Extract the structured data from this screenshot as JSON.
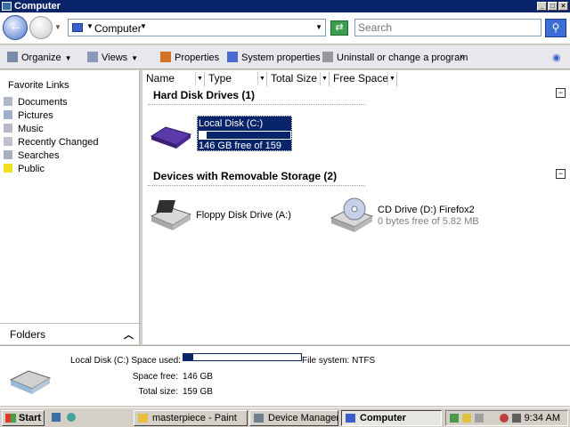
{
  "window": {
    "title": "Computer"
  },
  "address": {
    "location": "Computer",
    "search_placeholder": "Search"
  },
  "toolbar": {
    "organize": "Organize",
    "views": "Views",
    "properties": "Properties",
    "system_properties": "System properties",
    "uninstall": "Uninstall or change a program",
    "more": "»"
  },
  "sidebar": {
    "header": "Favorite Links",
    "items": [
      {
        "label": "Documents"
      },
      {
        "label": "Pictures"
      },
      {
        "label": "Music"
      },
      {
        "label": "Recently Changed"
      },
      {
        "label": "Searches"
      },
      {
        "label": "Public"
      }
    ],
    "folders_label": "Folders"
  },
  "columns": [
    "Name",
    "Type",
    "Total Size",
    "Free Space"
  ],
  "groups": {
    "hard_disks": {
      "heading": "Hard Disk Drives (1)",
      "drives": [
        {
          "name": "Local Disk (C:)",
          "free_text": "146 GB free of 159 GB",
          "used_fraction": 0.08
        }
      ]
    },
    "removable": {
      "heading": "Devices with Removable Storage (2)",
      "drives": [
        {
          "name": "Floppy Disk Drive (A:)"
        },
        {
          "name": "CD Drive (D:) Firefox2",
          "free_text": "0 bytes free of 5.82 MB"
        }
      ]
    }
  },
  "details": {
    "title": "Local Disk (C:) Space used:",
    "file_system": "File system: NTFS",
    "space_free_label": "Space free:",
    "space_free": "146 GB",
    "total_size_label": "Total size:",
    "total_size": "159 GB",
    "used_fraction": 0.08
  },
  "taskbar": {
    "start": "Start",
    "tasks": [
      {
        "label": "masterpiece - Paint"
      },
      {
        "label": "Device Manager"
      },
      {
        "label": "Computer",
        "active": true
      }
    ],
    "clock": "9:34 AM"
  },
  "colors": {
    "selection": "#0a246a",
    "titlebar": "#0a246a"
  }
}
